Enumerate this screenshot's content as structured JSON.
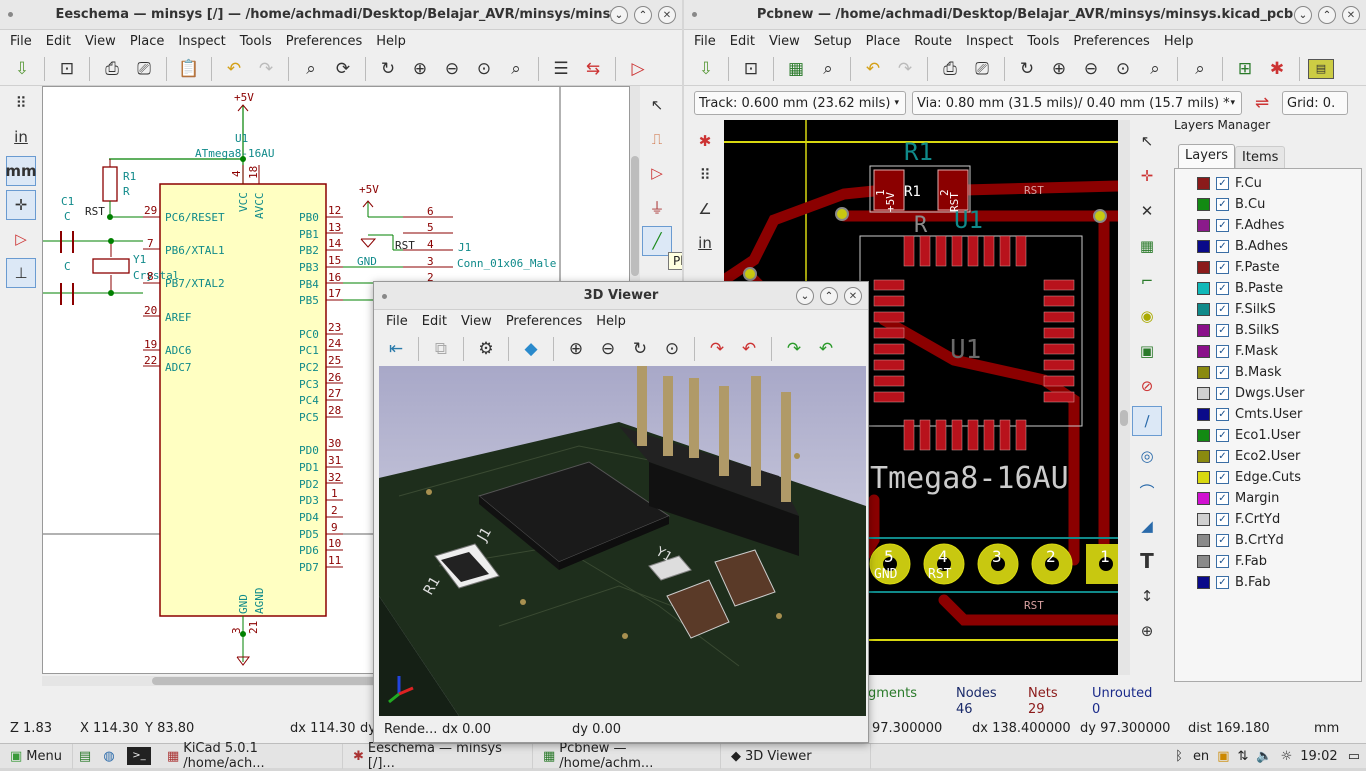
{
  "eeschema": {
    "title": "Eeschema — minsys [/] — /home/achmadi/Desktop/Belajar_AVR/minsys/minsys",
    "menu": [
      "File",
      "Edit",
      "View",
      "Place",
      "Inspect",
      "Tools",
      "Preferences",
      "Help"
    ],
    "left_tools": [
      "⠿",
      "in",
      "mm",
      "✛",
      "▷",
      "⊥"
    ],
    "right_tools": [
      "↖",
      "⎍",
      "▷",
      "⏚",
      "╱"
    ],
    "tooltip": "Place wire",
    "status": {
      "zoom": "Z 1.83",
      "x": "X 114.30",
      "y": "Y 83.80",
      "dx": "dx 114.30",
      "dy": "dy"
    },
    "schematic": {
      "power_top": "+5V",
      "u1_ref": "U1",
      "u1_value": "ATmega8-16AU",
      "r1_ref": "R1",
      "r1_value": "R",
      "c1_ref": "C1",
      "c1_value": "C",
      "c2_value": "C",
      "y1_ref": "Y1",
      "y1_value": "Crystal",
      "rst": "RST",
      "rst2": "RST",
      "gnd": "GND",
      "p5v": "+5V",
      "j1_ref": "J1",
      "j1_value": "Conn_01x06_Male",
      "pins_left": [
        "PC6/RESET",
        "PB6/XTAL1",
        "PB7/XTAL2",
        "AREF",
        "ADC6",
        "ADC7"
      ],
      "pin_nums_left": [
        "29",
        "7",
        "8",
        "20",
        "19",
        "22"
      ],
      "pins_right": [
        "PB0",
        "PB1",
        "PB2",
        "PB3",
        "PB4",
        "PB5",
        "PC0",
        "PC1",
        "PC2",
        "PC3",
        "PC4",
        "PC5",
        "PD0",
        "PD1",
        "PD2",
        "PD3",
        "PD4",
        "PD5",
        "PD6",
        "PD7"
      ],
      "pin_nums_right": [
        "12",
        "13",
        "14",
        "15",
        "16",
        "17",
        "23",
        "24",
        "25",
        "26",
        "27",
        "28",
        "30",
        "31",
        "32",
        "1",
        "2",
        "9",
        "10",
        "11"
      ],
      "top_pins": [
        "VCC",
        "AVCC"
      ],
      "top_nums": [
        "4",
        "18"
      ],
      "bottom_pins": [
        "GND",
        "AGND"
      ],
      "bottom_nums": [
        "3",
        "21"
      ],
      "conn_nums": [
        "6",
        "5",
        "4",
        "3",
        "2",
        "1"
      ]
    }
  },
  "pcbnew": {
    "title": "Pcbnew — /home/achmadi/Desktop/Belajar_AVR/minsys/minsys.kicad_pcb",
    "menu": [
      "File",
      "Edit",
      "View",
      "Setup",
      "Place",
      "Route",
      "Inspect",
      "Tools",
      "Preferences",
      "Help"
    ],
    "track": "Track: 0.600 mm (23.62 mils)",
    "via": "Via: 0.80 mm (31.5 mils)/ 0.40 mm (15.7 mils) *",
    "grid": "Grid: 0.",
    "layers_title": "Layers Manager",
    "tabs": [
      "Layers",
      "Items"
    ],
    "layers": [
      {
        "name": "F.Cu",
        "color": "#8b1a1a"
      },
      {
        "name": "B.Cu",
        "color": "#138a13"
      },
      {
        "name": "F.Adhes",
        "color": "#8b1a8b"
      },
      {
        "name": "B.Adhes",
        "color": "#0a0a8a"
      },
      {
        "name": "F.Paste",
        "color": "#8b1a1a"
      },
      {
        "name": "B.Paste",
        "color": "#10b8b8"
      },
      {
        "name": "F.SilkS",
        "color": "#108a8a"
      },
      {
        "name": "B.SilkS",
        "color": "#8a108a"
      },
      {
        "name": "F.Mask",
        "color": "#8a108a"
      },
      {
        "name": "B.Mask",
        "color": "#8a8a10"
      },
      {
        "name": "Dwgs.User",
        "color": "#d0d0d0"
      },
      {
        "name": "Cmts.User",
        "color": "#0a0a8a"
      },
      {
        "name": "Eco1.User",
        "color": "#138a13"
      },
      {
        "name": "Eco2.User",
        "color": "#8a8a10"
      },
      {
        "name": "Edge.Cuts",
        "color": "#d8d810"
      },
      {
        "name": "Margin",
        "color": "#d010d0"
      },
      {
        "name": "F.CrtYd",
        "color": "#d0d0d0"
      },
      {
        "name": "B.CrtYd",
        "color": "#8a8a8a"
      },
      {
        "name": "F.Fab",
        "color": "#8a8a8a"
      },
      {
        "name": "B.Fab",
        "color": "#0a0a8a"
      }
    ],
    "stats": {
      "segments_label": "egments",
      "nodes_label": "Nodes",
      "nodes": "46",
      "nets_label": "Nets",
      "nets": "29",
      "unrouted_label": "Unrouted",
      "unrouted": "0"
    },
    "status": {
      "y": "97.300000",
      "dx": "dx 138.400000",
      "dy": "dy 97.300000",
      "dist": "dist 169.180",
      "units": "mm"
    },
    "board": {
      "r1": "R1",
      "r1_val": "R",
      "u1": "U1",
      "u1_big": "U1",
      "chip_name": "Tmega8-16AU",
      "rst": "RST",
      "conn_labels": [
        "5",
        "4",
        "3",
        "2",
        "1"
      ],
      "conn_sub": [
        "GND",
        "RST"
      ],
      "pad_5v": "+5V",
      "pad_rst": "RST",
      "pad1": "1",
      "pad2": "2",
      "r1_pad": "R1"
    }
  },
  "viewer3d": {
    "title": "3D Viewer",
    "menu": [
      "File",
      "Edit",
      "View",
      "Preferences",
      "Help"
    ],
    "labels": {
      "r1": "R1",
      "j1": "J1",
      "y1": "Y1"
    },
    "status": {
      "render": "Rende...",
      "dx": "dx 0.00",
      "dy": "dy 0.00"
    }
  },
  "taskbar": {
    "menu": "Menu",
    "tasks": [
      "KiCad 5.0.1 /home/ach...",
      "Eeschema — minsys [/]...",
      "Pcbnew — /home/achm...",
      "3D Viewer"
    ],
    "lang": "en",
    "time": "19:02"
  }
}
